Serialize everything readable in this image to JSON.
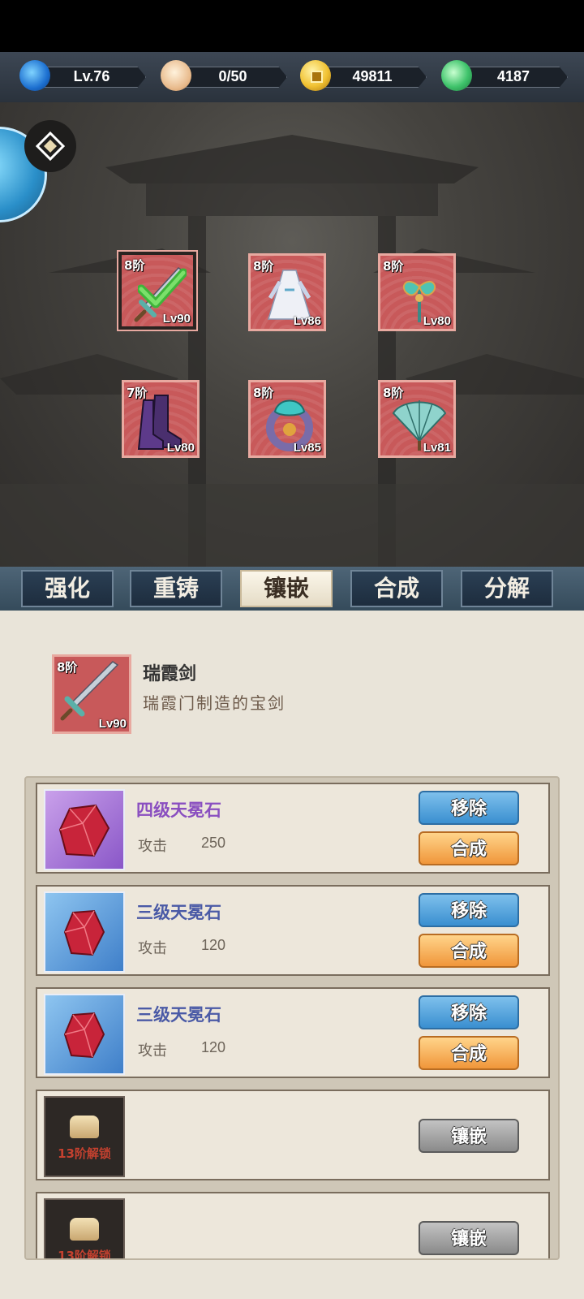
{
  "currency": {
    "level": "Lv.76",
    "stamina": "0/50",
    "coins": "49811",
    "jade": "4187"
  },
  "equipment": [
    {
      "tier": "8阶",
      "level": "Lv90",
      "name": "sword",
      "equipped": true
    },
    {
      "tier": "8阶",
      "level": "Lv86",
      "name": "robe",
      "equipped": false
    },
    {
      "tier": "8阶",
      "level": "Lv80",
      "name": "hairpin",
      "equipped": false
    },
    {
      "tier": "7阶",
      "level": "Lv80",
      "name": "boots",
      "equipped": false
    },
    {
      "tier": "8阶",
      "level": "Lv85",
      "name": "ring",
      "equipped": false
    },
    {
      "tier": "8阶",
      "level": "Lv81",
      "name": "fan",
      "equipped": false
    }
  ],
  "tabs": [
    "强化",
    "重铸",
    "镶嵌",
    "合成",
    "分解"
  ],
  "active_tab": "镶嵌",
  "selected_item": {
    "tier": "8阶",
    "level": "Lv90",
    "name": "瑞霞剑",
    "description": "瑞霞门制造的宝剑"
  },
  "gems": [
    {
      "name": "四级天冕石",
      "stat_label": "攻击",
      "stat_value": "250",
      "remove": "移除",
      "combine": "合成"
    },
    {
      "name": "三级天冕石",
      "stat_label": "攻击",
      "stat_value": "120",
      "remove": "移除",
      "combine": "合成"
    },
    {
      "name": "三级天冕石",
      "stat_label": "攻击",
      "stat_value": "120",
      "remove": "移除",
      "combine": "合成"
    }
  ],
  "locked_slots": [
    {
      "unlock_text": "13阶解锁",
      "action": "镶嵌"
    },
    {
      "unlock_text": "13阶解锁",
      "action": "镶嵌"
    }
  ],
  "colors": {
    "slot_red": "#c8595a",
    "gem_purple": "#8a4fc0",
    "gem_blue": "#4a5aa6",
    "button_blue": "#3a8fd0",
    "button_orange": "#f0963a"
  }
}
